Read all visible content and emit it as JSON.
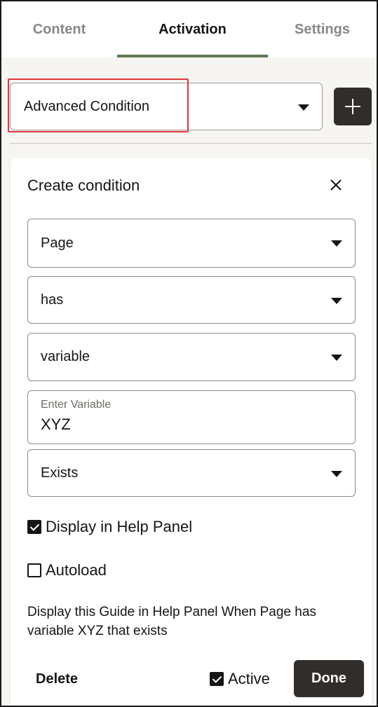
{
  "tabs": [
    {
      "label": "Content",
      "active": false
    },
    {
      "label": "Activation",
      "active": true
    },
    {
      "label": "Settings",
      "active": false
    }
  ],
  "top_select": {
    "value": "Advanced Condition"
  },
  "add_button": {
    "icon": "plus-icon"
  },
  "panel": {
    "title": "Create condition",
    "close_icon": "close-icon",
    "fields": {
      "object_select": "Page",
      "operator_select": "has",
      "type_select": "variable",
      "variable_input": {
        "label": "Enter Variable",
        "value": "XYZ"
      },
      "condition_select": "Exists"
    },
    "checkboxes": {
      "display_in_help_panel": {
        "label": "Display in Help Panel",
        "checked": true
      },
      "autoload": {
        "label": "Autoload",
        "checked": false
      }
    },
    "summary": "Display this Guide in Help Panel When Page has variable XYZ that exists",
    "footer": {
      "delete_label": "Delete",
      "active_label": "Active",
      "active_checked": true,
      "done_label": "Done"
    }
  },
  "colors": {
    "accent_underline": "#5e7a4f",
    "highlight": "#e3343c",
    "dark_button": "#312d2a"
  }
}
